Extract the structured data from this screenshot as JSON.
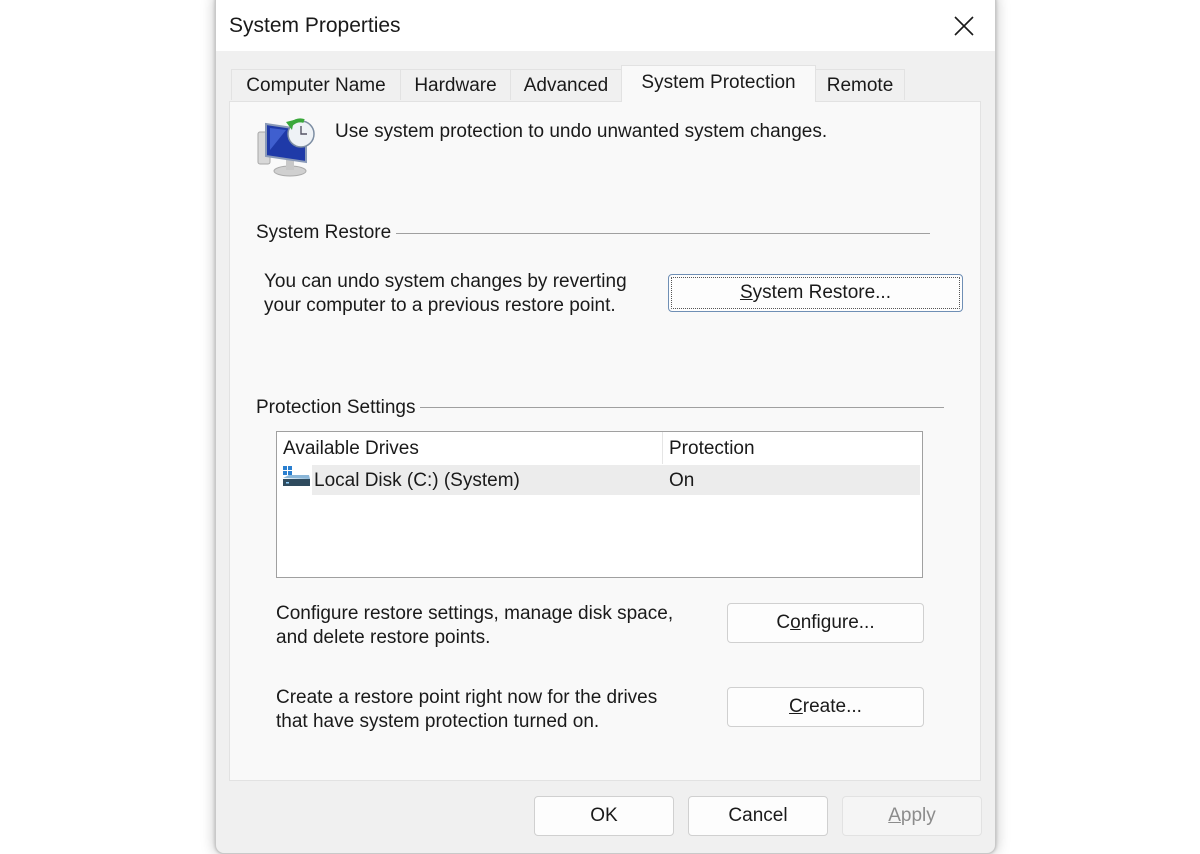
{
  "window": {
    "title": "System Properties",
    "close_icon": "close-icon"
  },
  "tabs": [
    {
      "label": "Computer Name",
      "active": false
    },
    {
      "label": "Hardware",
      "active": false
    },
    {
      "label": "Advanced",
      "active": false
    },
    {
      "label": "System Protection",
      "active": true
    },
    {
      "label": "Remote",
      "active": false
    }
  ],
  "intro": {
    "icon": "system-restore-icon",
    "text": "Use system protection to undo unwanted system changes."
  },
  "system_restore": {
    "group_label": "System Restore",
    "description_line1": "You can undo system changes by reverting",
    "description_line2": "your computer to a previous restore point.",
    "button": {
      "pre": "",
      "mnemonic": "S",
      "post": "ystem Restore..."
    }
  },
  "protection_settings": {
    "group_label": "Protection Settings",
    "columns": [
      "Available Drives",
      "Protection"
    ],
    "drives": [
      {
        "icon": "system-drive-icon",
        "name": "Local Disk (C:) (System)",
        "protection": "On",
        "selected": true
      }
    ],
    "configure": {
      "description_line1": "Configure restore settings, manage disk space,",
      "description_line2": "and delete restore points.",
      "button": {
        "pre": "C",
        "mnemonic": "o",
        "post": "nfigure..."
      }
    },
    "create": {
      "description_line1": "Create a restore point right now for the drives",
      "description_line2": "that have system protection turned on.",
      "button": {
        "pre": "",
        "mnemonic": "C",
        "post": "reate..."
      }
    }
  },
  "footer": {
    "ok": "OK",
    "cancel": "Cancel",
    "apply": {
      "pre": "",
      "mnemonic": "A",
      "post": "pply",
      "disabled": true
    }
  }
}
